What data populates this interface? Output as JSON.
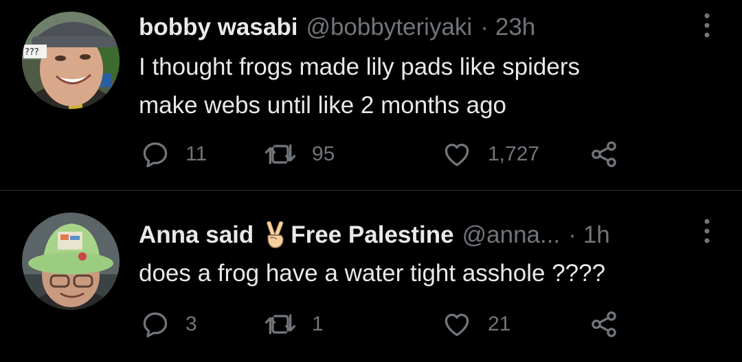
{
  "tweets": [
    {
      "display_name": "bobby wasabi",
      "handle": "@bobbyteriyaki",
      "separator": "·",
      "time": "23h",
      "text_lines": [
        "I thought frogs made lily pads like spiders",
        "make webs until like 2 months ago"
      ],
      "avatar_sign_text": "???",
      "counts": {
        "replies": "11",
        "retweets": "95",
        "likes": "1,727"
      }
    },
    {
      "display_name_part1": "Anna said",
      "display_name_emoji": "victory-hand-emoji",
      "display_name_part2": "Free Palestine",
      "handle": "@anna...",
      "separator": "·",
      "time": "1h",
      "text_lines": [
        "does a frog have a water tight asshole ????"
      ],
      "counts": {
        "replies": "3",
        "retweets": "1",
        "likes": "21"
      }
    }
  ],
  "icons": [
    "more-icon",
    "reply-icon",
    "retweet-icon",
    "like-icon",
    "share-icon"
  ],
  "colors": {
    "background": "#000000",
    "primary_text": "#e7e9ea",
    "secondary_text": "#71767b",
    "divider": "#2f3336"
  }
}
